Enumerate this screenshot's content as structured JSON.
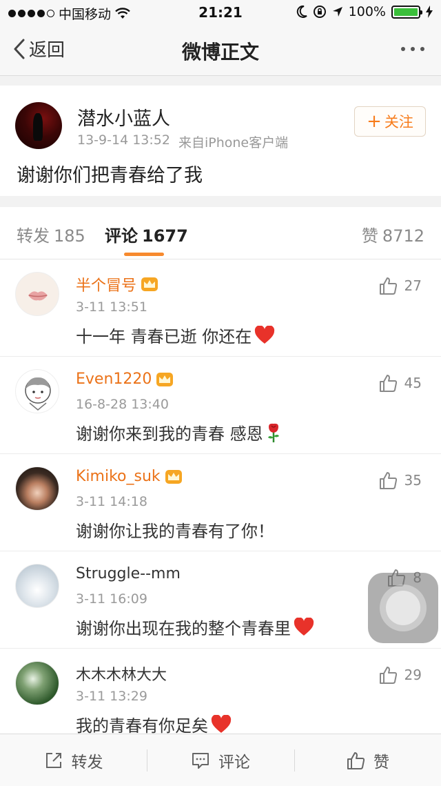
{
  "status_bar": {
    "carrier": "中国移动",
    "time": "21:21",
    "battery": "100%"
  },
  "nav": {
    "back_label": "返回",
    "title": "微博正文"
  },
  "post": {
    "author": "潜水小蓝人",
    "date": "13-9-14 13:52",
    "source": "来自iPhone客户端",
    "follow_label": "关注",
    "text": "谢谢你们把青春给了我"
  },
  "tabs": {
    "repost": {
      "label": "转发",
      "count": "185"
    },
    "comment": {
      "label": "评论",
      "count": "1677"
    },
    "like": {
      "label": "赞",
      "count": "8712"
    }
  },
  "comments": [
    {
      "name": "半个冒号",
      "time": "3-11 13:51",
      "text": "十一年  青春已逝  你还在",
      "likes": "27"
    },
    {
      "name": "Even1220",
      "time": "16-8-28 13:40",
      "text": "谢谢你来到我的青春  感恩",
      "likes": "45"
    },
    {
      "name": "Kimiko_suk",
      "time": "3-11 14:18",
      "text": "谢谢你让我的青春有了你！",
      "likes": "35"
    },
    {
      "name": "Struggle--mm",
      "time": "3-11 16:09",
      "text": "谢谢你出现在我的整个青春里",
      "likes": "8"
    },
    {
      "name": "木木木林大大",
      "time": "3-11 13:29",
      "text": "我的青春有你足矣",
      "likes": "29"
    }
  ],
  "toolbar": {
    "repost_label": "转发",
    "comment_label": "评论",
    "like_label": "赞"
  },
  "colors": {
    "accent_orange": "#f78a2e",
    "vip_name": "#eb7218",
    "heart_red": "#e8322a"
  }
}
